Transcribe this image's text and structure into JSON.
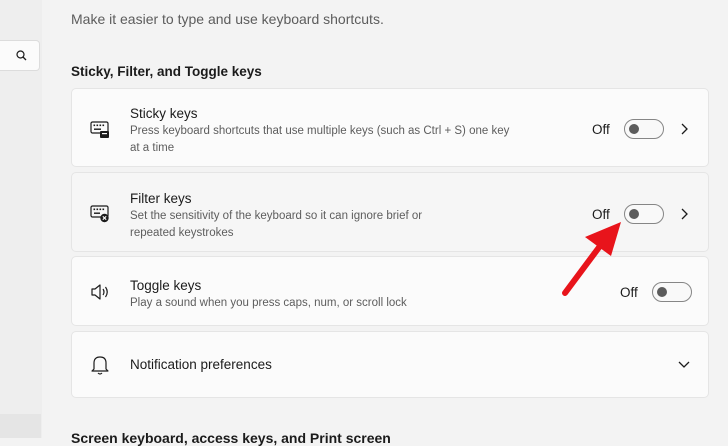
{
  "header": {
    "subtitle": "Make it easier to type and use keyboard shortcuts."
  },
  "left_pane": {
    "search_icon": "search-icon"
  },
  "section": {
    "title": "Sticky, Filter, and Toggle keys"
  },
  "items": [
    {
      "title": "Sticky keys",
      "description": "Press keyboard shortcuts that use multiple keys (such as Ctrl + S) one key at a time",
      "toggle_state": "Off",
      "icon": "sticky-keys-icon"
    },
    {
      "title": "Filter keys",
      "description": "Set the sensitivity of the keyboard so it can ignore brief or repeated keystrokes",
      "toggle_state": "Off",
      "icon": "filter-keys-icon"
    },
    {
      "title": "Toggle keys",
      "description": "Play a sound when you press caps, num, or scroll lock",
      "toggle_state": "Off",
      "icon": "speaker-icon"
    }
  ],
  "notification": {
    "title": "Notification preferences",
    "icon": "bell-icon"
  },
  "next_section": {
    "title": "Screen keyboard, access keys, and Print screen"
  },
  "colors": {
    "annotation_arrow": "#e8141b",
    "background": "#f3f3f3",
    "card": "#fbfbfb"
  }
}
